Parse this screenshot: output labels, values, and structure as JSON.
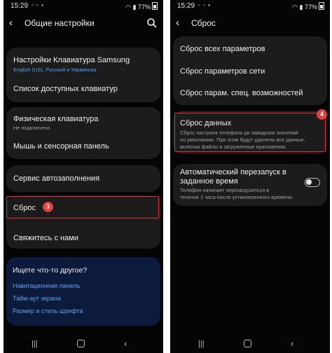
{
  "left": {
    "status": {
      "time": "15:29",
      "battery": "77%"
    },
    "title": "Общие настройки",
    "items": [
      {
        "label": "Настройки Клавиатура Samsung",
        "sub": "English (US), Русский и Украинска"
      },
      {
        "label": "Список доступных клавиатур"
      },
      {
        "label": "Физическая клавиатура",
        "sub": "Не подключено"
      },
      {
        "label": "Мышь и сенсорная панель"
      },
      {
        "label": "Сервис автозаполнения"
      },
      {
        "label": "Сброс"
      },
      {
        "label": "Свяжитесь с нами"
      }
    ],
    "badge": "3",
    "help": {
      "title": "Ищете что-то другое?",
      "links": [
        "Навигационная панель",
        "Тайм-аут экрана",
        "Размер и стиль шрифта"
      ]
    }
  },
  "right": {
    "status": {
      "time": "15:29",
      "battery": "77%"
    },
    "title": "Сброс",
    "items": [
      {
        "label": "Сброс всех параметров"
      },
      {
        "label": "Сброс параметров сети"
      },
      {
        "label": "Сброс парам. спец. возможностей"
      },
      {
        "label": "Сброс данных",
        "desc": [
          "Сброс настроек телефона до заводских значений",
          "по умолчанию. При этом будут удалены все данные,",
          "включая файлы и загруженные приложения."
        ]
      },
      {
        "label": [
          "Автоматический перезапуск в",
          "заданное время"
        ],
        "desc": [
          "Телефон начинает перезагрузиться в",
          "течение 1 часа после установленного времени."
        ],
        "toggle": false
      }
    ],
    "badge": "4"
  }
}
